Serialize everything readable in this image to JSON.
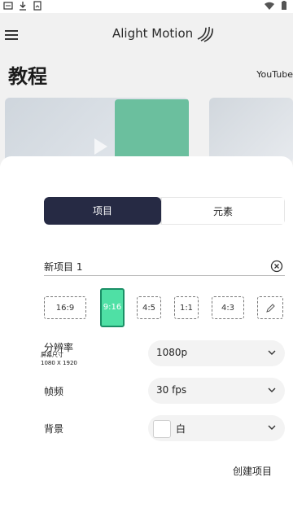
{
  "statusbar": {
    "left_icons": [
      "app-icon",
      "download-icon",
      "gallery-icon"
    ],
    "right_icons": [
      "wifi-icon",
      "battery-icon"
    ]
  },
  "appbar": {
    "logo_text": "Alight Motion"
  },
  "tutorials": {
    "title": "教程",
    "youtube_label": "YouTube"
  },
  "sheet": {
    "tabs": [
      {
        "label": "项目",
        "active": true
      },
      {
        "label": "元素",
        "active": false
      }
    ],
    "project_name": "新项目 1",
    "ratios": [
      {
        "label": "16:9",
        "active": false
      },
      {
        "label": "9:16",
        "active": true
      },
      {
        "label": "4:5",
        "active": false
      },
      {
        "label": "1:1",
        "active": false
      },
      {
        "label": "4:3",
        "active": false
      },
      {
        "label": "edit-icon",
        "active": false
      }
    ],
    "resolution": {
      "label": "分辨率",
      "sub1": "屏幕尺寸",
      "sub2": "1080 X 1920",
      "value": "1080p"
    },
    "framerate": {
      "label": "帧频",
      "value": "30 fps"
    },
    "background": {
      "label": "背景",
      "value": "白",
      "color": "#ffffff"
    },
    "create_label": "创建项目"
  },
  "colors": {
    "tab_active_bg": "#262a44",
    "ratio_active_bg": "#4fe0a5"
  }
}
